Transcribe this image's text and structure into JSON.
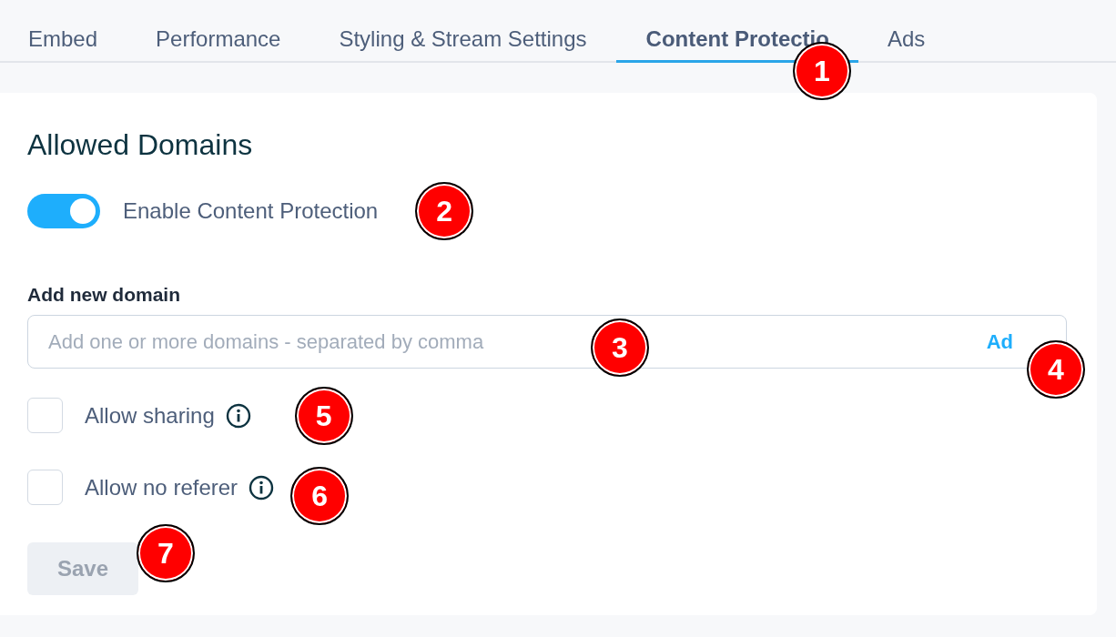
{
  "tabs": [
    {
      "label": "Embed",
      "selected": false
    },
    {
      "label": "Performance",
      "selected": false
    },
    {
      "label": "Styling & Stream Settings",
      "selected": false
    },
    {
      "label": "Content Protectio",
      "selected": true,
      "callout": "1"
    },
    {
      "label": "Ads",
      "selected": false
    }
  ],
  "section": {
    "title": "Allowed Domains"
  },
  "toggle": {
    "label": "Enable Content Protection",
    "on": true,
    "callout": "2"
  },
  "domain_field": {
    "label": "Add new domain",
    "placeholder": "Add one or more domains - separated by comma",
    "callout": "3",
    "add_button": {
      "label": "Ad",
      "callout": "4"
    }
  },
  "options": [
    {
      "label": "Allow sharing",
      "checked": false,
      "callout": "5"
    },
    {
      "label": "Allow no referer",
      "checked": false,
      "callout": "6"
    }
  ],
  "save_button": {
    "label": "Save",
    "disabled": true,
    "callout": "7"
  }
}
